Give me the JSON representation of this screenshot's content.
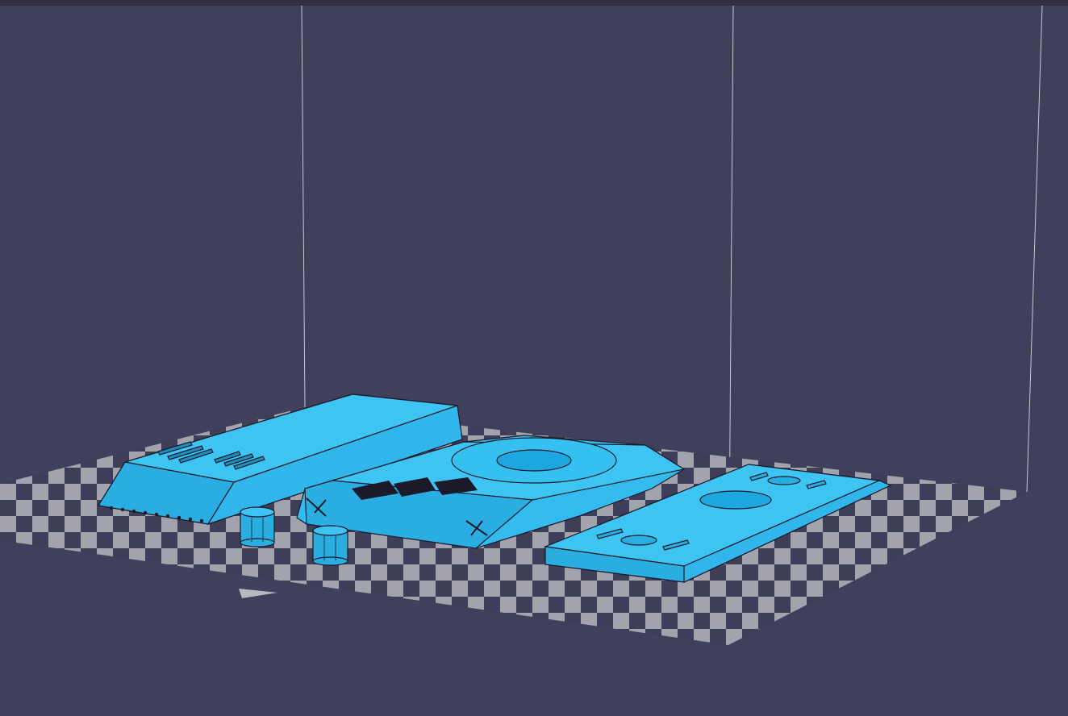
{
  "scene": {
    "background_color": "#40405c",
    "model_color": "#33bbee",
    "model_shadow_color": "#1f8fc0",
    "bed_light_color": "#a3a3ad",
    "bed_dark_color": "#3e3e58",
    "edge_color": "#1a1a2a",
    "objects": [
      {
        "name": "side-armor-plate"
      },
      {
        "name": "hull-top"
      },
      {
        "name": "turret-ring-plate"
      },
      {
        "name": "small-cylinder"
      },
      {
        "name": "small-cylinder"
      }
    ]
  }
}
